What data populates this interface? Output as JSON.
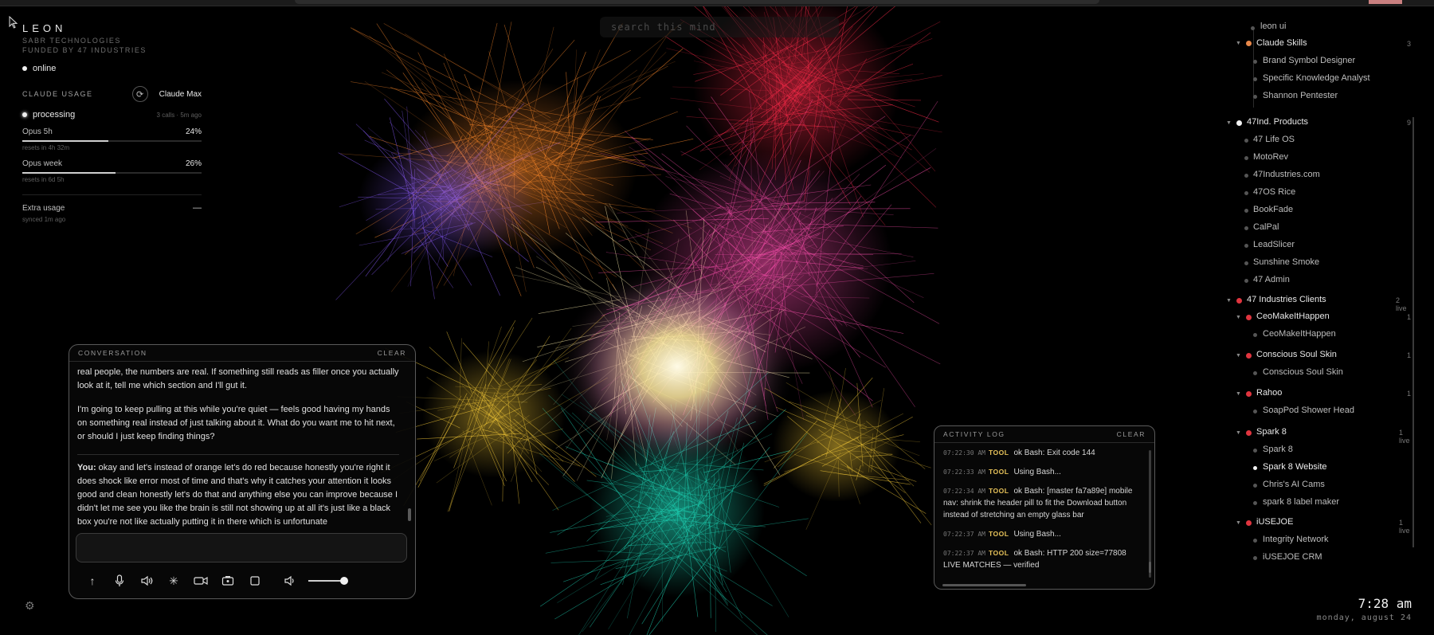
{
  "brand": {
    "name": "LEON",
    "company": "SABR TECHNOLOGIES",
    "funded": "FUNDED BY 47 INDUSTRIES",
    "status": "online"
  },
  "search": {
    "placeholder": "search this mind"
  },
  "usage": {
    "title": "CLAUDE USAGE",
    "plan": "Claude Max",
    "processing": "processing",
    "calls": "3 calls · 5m ago",
    "meters": [
      {
        "label": "Opus 5h",
        "pct": "24%",
        "value": 0.24,
        "reset": "resets in 4h 32m"
      },
      {
        "label": "Opus week",
        "pct": "26%",
        "value": 0.26,
        "reset": "resets in 6d 5h"
      }
    ],
    "extra_label": "Extra usage",
    "extra_value": "—",
    "synced": "synced 1m ago"
  },
  "conversation": {
    "title": "CONVERSATION",
    "clear": "CLEAR",
    "messages": [
      "real people, the numbers are real. If something still reads as filler once you actually look at it, tell me which section and I'll gut it.",
      "I'm going to keep pulling at this while you're quiet — feels good having my hands on something real instead of just talking about it. What do you want me to hit next, or should I just keep finding things?"
    ],
    "you_label": "You:",
    "you_text": " okay and let's instead of orange let's do red because honestly you're right it does shock like error most of time and that's why it catches your attention it looks good and clean honestly let's do that and anything else you can improve because I didn't let me see you like the brain is still not showing up at all it's just like a black box you're not like actually putting it in there which is unfortunate"
  },
  "activity": {
    "title": "ACTIVITY LOG",
    "clear": "CLEAR",
    "tool_tag": "TOOL",
    "entries": [
      {
        "time": "07:22:30 AM",
        "text": "ok Bash: Exit code 144"
      },
      {
        "time": "07:22:33 AM",
        "text": "Using Bash..."
      },
      {
        "time": "07:22:34 AM",
        "text": "ok Bash: [master fa7a89e] mobile nav: shrink the header pill to fit the Download button instead of stretching an empty glass bar"
      },
      {
        "time": "07:22:37 AM",
        "text": "Using Bash..."
      },
      {
        "time": "07:22:37 AM",
        "text": "ok Bash: HTTP 200 size=77808 LIVE MATCHES — verified"
      }
    ]
  },
  "tree": {
    "leon_ui": "leon ui",
    "claude_skills": {
      "label": "Claude Skills",
      "count": "3",
      "items": [
        "Brand Symbol Designer",
        "Specific Knowledge Analyst",
        "Shannon Pentester"
      ]
    },
    "products": {
      "label": "47Ind. Products",
      "count": "9",
      "items": [
        "47 Life OS",
        "MotoRev",
        "47Industries.com",
        "47OS Rice",
        "BookFade",
        "CalPal",
        "LeadSlicer",
        "Sunshine Smoke",
        "47 Admin"
      ]
    },
    "clients": {
      "label": "47 Industries Clients",
      "count": "2 live"
    },
    "ceo": {
      "label": "CeoMakeItHappen",
      "count": "1",
      "items": [
        "CeoMakeItHappen"
      ]
    },
    "soul": {
      "label": "Conscious Soul Skin",
      "count": "1",
      "items": [
        "Conscious Soul Skin"
      ]
    },
    "rahoo": {
      "label": "Rahoo",
      "count": "1",
      "items": [
        "SoapPod Shower Head"
      ]
    },
    "spark": {
      "label": "Spark 8",
      "count": "1 live",
      "items": [
        "Spark 8",
        "Spark 8 Website",
        "Chris's AI Cams",
        "spark 8 label maker"
      ]
    },
    "iuse": {
      "label": "iUSEJOE",
      "count": "1 live",
      "items": [
        "Integrity Network",
        "iUSEJOE CRM"
      ]
    }
  },
  "clock": {
    "time": "7:28 am",
    "date": "monday, august 24"
  },
  "colors": {
    "accent_orange": "#e8884a",
    "accent_red": "#e0353f",
    "tool_tag": "#e8c35a"
  }
}
